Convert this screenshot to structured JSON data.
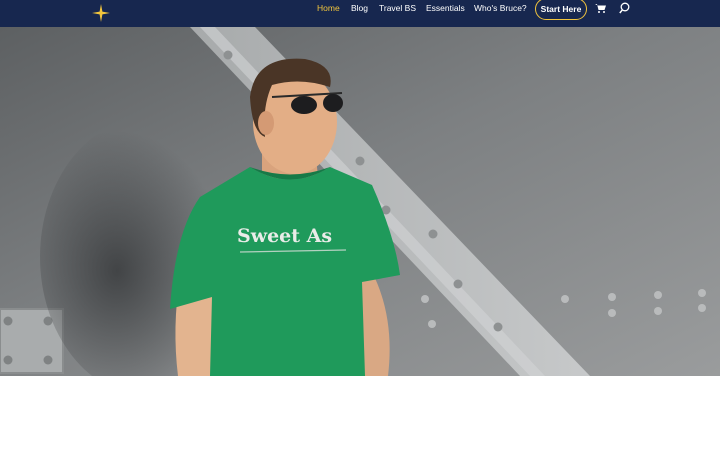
{
  "nav": {
    "items": [
      {
        "label": "Home",
        "active": true
      },
      {
        "label": "Blog"
      },
      {
        "label": "Travel BS"
      },
      {
        "label": "Essentials"
      },
      {
        "label": "Who's Bruce?"
      }
    ],
    "cta_label": "Start Here",
    "icons": [
      "star-logo-icon",
      "cart-icon",
      "search-icon"
    ]
  },
  "hero": {
    "shirt_text": "Sweet As"
  },
  "colors": {
    "navbar": "#17274f",
    "accent": "#f2c53d",
    "shirt": "#1f9a5b",
    "wall": "#7b7e80"
  }
}
